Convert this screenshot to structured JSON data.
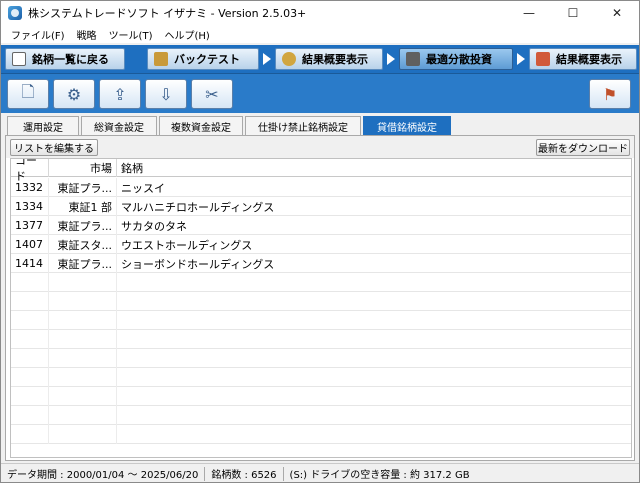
{
  "window": {
    "title": "株システムトレードソフト イザナミ - Version 2.5.03+",
    "controls": [
      "—",
      "☐",
      "✕"
    ]
  },
  "menu": [
    "ファイル(F)",
    "戦略",
    "ツール(T)",
    "ヘルプ(H)"
  ],
  "nav": {
    "items": [
      {
        "label": "銘柄一覧に戻る",
        "icon": "eye-icon",
        "color": "#ffffff"
      },
      {
        "label": "バックテスト",
        "icon": "money-bag-icon",
        "color": "#c99a3a"
      },
      {
        "label": "結果概要表示",
        "icon": "coins-icon",
        "color": "#d1a640"
      },
      {
        "label": "最適分散投資",
        "icon": "calculator-icon",
        "color": "#606060"
      },
      {
        "label": "結果概要表示",
        "icon": "chart-icon",
        "color": "#d15a3a"
      }
    ],
    "active_index": 3
  },
  "toolbar": {
    "buttons": [
      {
        "name": "new-document",
        "glyph": "🗋"
      },
      {
        "name": "open-settings",
        "glyph": "⚙"
      },
      {
        "name": "export",
        "glyph": "⇪"
      },
      {
        "name": "import",
        "glyph": "⇩"
      },
      {
        "name": "tools",
        "glyph": "✂"
      },
      {
        "name": "stamp",
        "glyph": "⚑"
      }
    ]
  },
  "tabs": {
    "items": [
      "運用設定",
      "総資金設定",
      "複数資金設定",
      "仕掛け禁止銘柄設定",
      "貸借銘柄設定"
    ],
    "active_index": 4
  },
  "panel": {
    "edit_list_label": "リストを編集する",
    "download_latest_label": "最新をダウンロード",
    "columns": [
      "コード",
      "市場",
      "銘柄"
    ],
    "rows": [
      {
        "code": "1332",
        "market": "東証プラ...",
        "name": "ニッスイ"
      },
      {
        "code": "1334",
        "market": "東証1 部",
        "name": "マルハニチロホールディングス"
      },
      {
        "code": "1377",
        "market": "東証プラ...",
        "name": "サカタのタネ"
      },
      {
        "code": "1407",
        "market": "東証スタ...",
        "name": "ウエストホールディングス"
      },
      {
        "code": "1414",
        "market": "東証プラ...",
        "name": "ショーボンドホールディングス"
      }
    ]
  },
  "status": {
    "data_period": "データ期間 : 2000/01/04 〜 2025/06/20",
    "stock_count": "銘柄数 : 6526",
    "disk_free": "(S:) ドライブの空き容量 : 約 317.2 GB"
  }
}
